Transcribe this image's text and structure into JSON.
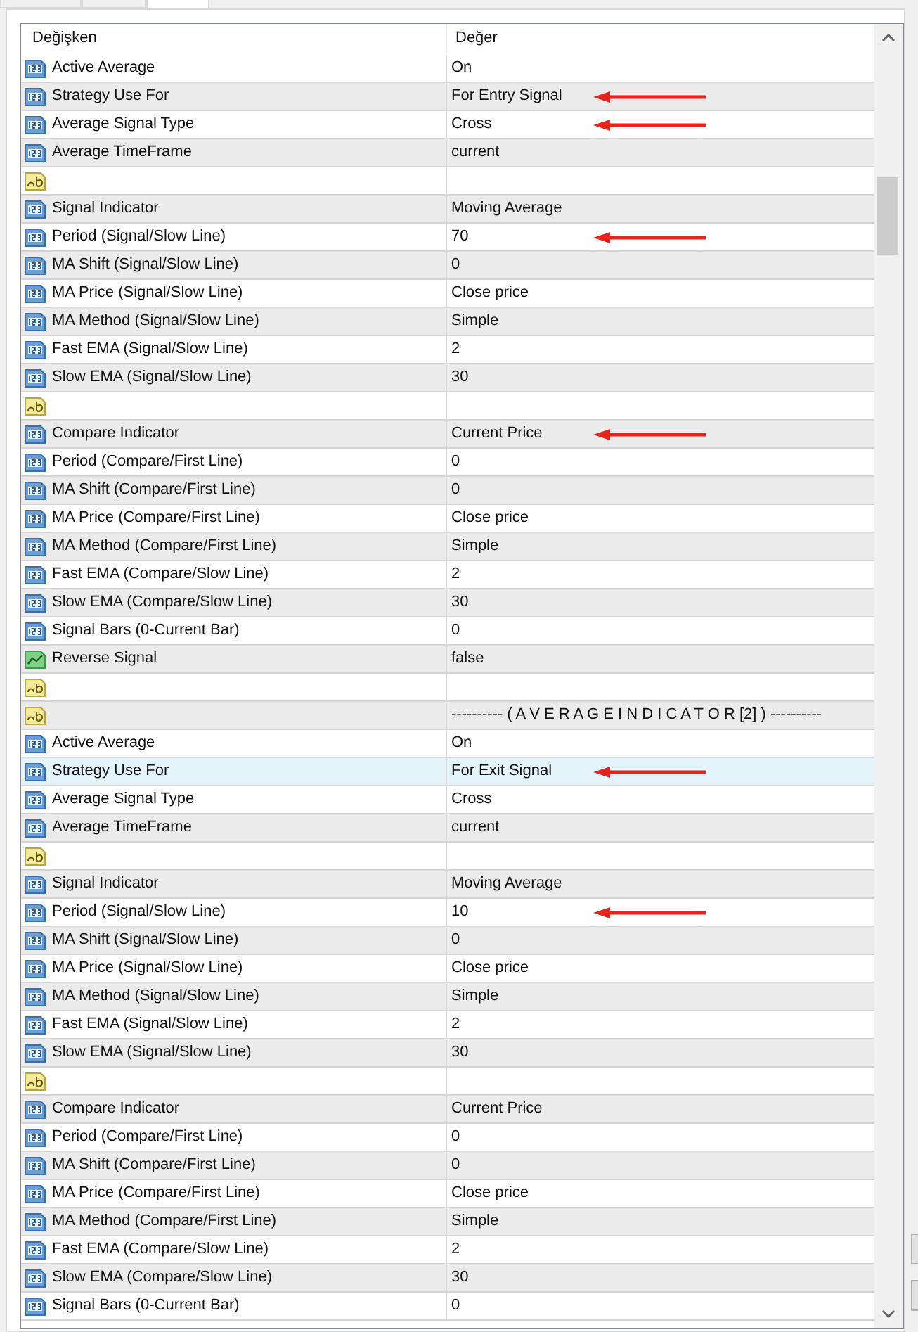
{
  "table": {
    "columns": [
      "Değişken",
      "Değer"
    ],
    "rows": [
      {
        "kind": "number",
        "name": "Active Average",
        "value": "On",
        "arrow": false,
        "selected": false
      },
      {
        "kind": "number",
        "name": "Strategy Use For",
        "value": "For Entry Signal",
        "arrow": true,
        "selected": false
      },
      {
        "kind": "number",
        "name": "Average Signal Type",
        "value": "Cross",
        "arrow": true,
        "selected": false
      },
      {
        "kind": "number",
        "name": "Average TimeFrame",
        "value": "current",
        "arrow": false,
        "selected": false
      },
      {
        "kind": "text",
        "name": "",
        "value": "",
        "arrow": false,
        "selected": false
      },
      {
        "kind": "number",
        "name": "Signal Indicator",
        "value": "Moving Average",
        "arrow": false,
        "selected": false
      },
      {
        "kind": "number",
        "name": "Period (Signal/Slow Line)",
        "value": "70",
        "arrow": true,
        "selected": false
      },
      {
        "kind": "number",
        "name": "MA Shift (Signal/Slow Line)",
        "value": "0",
        "arrow": false,
        "selected": false
      },
      {
        "kind": "number",
        "name": "MA Price (Signal/Slow Line)",
        "value": "Close price",
        "arrow": false,
        "selected": false
      },
      {
        "kind": "number",
        "name": "MA Method (Signal/Slow Line)",
        "value": "Simple",
        "arrow": false,
        "selected": false
      },
      {
        "kind": "number",
        "name": "Fast EMA (Signal/Slow Line)",
        "value": "2",
        "arrow": false,
        "selected": false
      },
      {
        "kind": "number",
        "name": "Slow EMA (Signal/Slow Line)",
        "value": "30",
        "arrow": false,
        "selected": false
      },
      {
        "kind": "text",
        "name": "",
        "value": "",
        "arrow": false,
        "selected": false
      },
      {
        "kind": "number",
        "name": "Compare Indicator",
        "value": "Current Price",
        "arrow": true,
        "selected": false
      },
      {
        "kind": "number",
        "name": "Period (Compare/First Line)",
        "value": "0",
        "arrow": false,
        "selected": false
      },
      {
        "kind": "number",
        "name": "MA Shift (Compare/First Line)",
        "value": "0",
        "arrow": false,
        "selected": false
      },
      {
        "kind": "number",
        "name": "MA Price (Compare/First Line)",
        "value": "Close price",
        "arrow": false,
        "selected": false
      },
      {
        "kind": "number",
        "name": "MA Method (Compare/First Line)",
        "value": "Simple",
        "arrow": false,
        "selected": false
      },
      {
        "kind": "number",
        "name": "Fast EMA (Compare/Slow Line)",
        "value": "2",
        "arrow": false,
        "selected": false
      },
      {
        "kind": "number",
        "name": "Slow EMA (Compare/Slow Line)",
        "value": "30",
        "arrow": false,
        "selected": false
      },
      {
        "kind": "number",
        "name": "Signal Bars (0-Current Bar)",
        "value": "0",
        "arrow": false,
        "selected": false
      },
      {
        "kind": "bool",
        "name": "Reverse Signal",
        "value": "false",
        "arrow": false,
        "selected": false
      },
      {
        "kind": "text",
        "name": "",
        "value": "",
        "arrow": false,
        "selected": false
      },
      {
        "kind": "text",
        "name": "",
        "value": "---------- ( A V E R A G E   I N D I C A T O R  [2] ) ----------",
        "arrow": false,
        "selected": false
      },
      {
        "kind": "number",
        "name": "Active Average",
        "value": "On",
        "arrow": false,
        "selected": false
      },
      {
        "kind": "number",
        "name": "Strategy Use For",
        "value": "For Exit Signal",
        "arrow": true,
        "selected": true
      },
      {
        "kind": "number",
        "name": "Average Signal Type",
        "value": "Cross",
        "arrow": false,
        "selected": false
      },
      {
        "kind": "number",
        "name": "Average TimeFrame",
        "value": "current",
        "arrow": false,
        "selected": false
      },
      {
        "kind": "text",
        "name": "",
        "value": "",
        "arrow": false,
        "selected": false
      },
      {
        "kind": "number",
        "name": "Signal Indicator",
        "value": "Moving Average",
        "arrow": false,
        "selected": false
      },
      {
        "kind": "number",
        "name": "Period (Signal/Slow Line)",
        "value": "10",
        "arrow": true,
        "selected": false
      },
      {
        "kind": "number",
        "name": "MA Shift (Signal/Slow Line)",
        "value": "0",
        "arrow": false,
        "selected": false
      },
      {
        "kind": "number",
        "name": "MA Price (Signal/Slow Line)",
        "value": "Close price",
        "arrow": false,
        "selected": false
      },
      {
        "kind": "number",
        "name": "MA Method (Signal/Slow Line)",
        "value": "Simple",
        "arrow": false,
        "selected": false
      },
      {
        "kind": "number",
        "name": "Fast EMA (Signal/Slow Line)",
        "value": "2",
        "arrow": false,
        "selected": false
      },
      {
        "kind": "number",
        "name": "Slow EMA (Signal/Slow Line)",
        "value": "30",
        "arrow": false,
        "selected": false
      },
      {
        "kind": "text",
        "name": "",
        "value": "",
        "arrow": false,
        "selected": false
      },
      {
        "kind": "number",
        "name": "Compare Indicator",
        "value": "Current Price",
        "arrow": false,
        "selected": false
      },
      {
        "kind": "number",
        "name": "Period (Compare/First Line)",
        "value": "0",
        "arrow": false,
        "selected": false
      },
      {
        "kind": "number",
        "name": "MA Shift (Compare/First Line)",
        "value": "0",
        "arrow": false,
        "selected": false
      },
      {
        "kind": "number",
        "name": "MA Price (Compare/First Line)",
        "value": "Close price",
        "arrow": false,
        "selected": false
      },
      {
        "kind": "number",
        "name": "MA Method (Compare/First Line)",
        "value": "Simple",
        "arrow": false,
        "selected": false
      },
      {
        "kind": "number",
        "name": "Fast EMA (Compare/Slow Line)",
        "value": "2",
        "arrow": false,
        "selected": false
      },
      {
        "kind": "number",
        "name": "Slow EMA (Compare/Slow Line)",
        "value": "30",
        "arrow": false,
        "selected": false
      },
      {
        "kind": "number",
        "name": "Signal Bars (0-Current Bar)",
        "value": "0",
        "arrow": false,
        "selected": false
      }
    ]
  }
}
